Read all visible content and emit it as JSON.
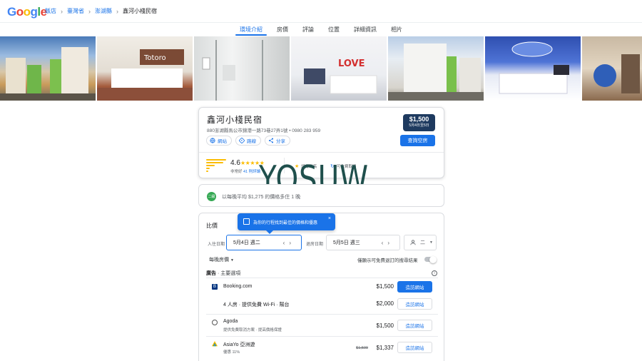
{
  "header": {
    "logo": "Google",
    "breadcrumbs": [
      "飯店",
      "臺灣省",
      "澎湖縣",
      "鑫河小棧民宿"
    ]
  },
  "tabs": [
    {
      "label": "環境介紹",
      "active": true
    },
    {
      "label": "房價",
      "active": false
    },
    {
      "label": "評論",
      "active": false
    },
    {
      "label": "位置",
      "active": false
    },
    {
      "label": "詳細資訊",
      "active": false
    },
    {
      "label": "相片",
      "active": false
    }
  ],
  "hotel": {
    "name": "鑫河小棧民宿",
    "address": "880澎湖縣馬公市錦港一路73巷27弄1號 • 0980 283 959",
    "actions": {
      "website": "網站",
      "directions": "路線",
      "share": "分享"
    },
    "price_badge": "$1,500",
    "price_badge_dates": "5月4日至5日",
    "check_button": "查詢空房",
    "rating": "4.6",
    "rating_text": "非常好",
    "review_count": "41 則評論",
    "feature_1": "評分最高",
    "feature_2": "可免費取消"
  },
  "watermark": "YOSUW",
  "promo": {
    "icon": "二級",
    "text": "以每晚平均 $1,275 的價格多住 1 晚"
  },
  "compare": {
    "title": "比價",
    "tooltip": "為你的行程找到最佳的價格和優惠",
    "checkin_label": "入住日期",
    "checkin_value": "5月4日 週二",
    "checkout_label": "退房日期",
    "checkout_value": "5月5日 週三",
    "guests": "二",
    "per_night": "每晚房價",
    "toggle_label": "僅顯示可免費退訂的搜尋結果",
    "ad_prefix": "廣告",
    "ad_title": "主要選項",
    "offers": [
      {
        "provider": "Booking.com",
        "sub": "",
        "price": "$1,500",
        "old_price": "",
        "button": "造訪網站",
        "primary": true
      },
      {
        "provider": "4 人房 · 提供免費 Wi-Fi · 陽台",
        "sub": "",
        "price": "$2,000",
        "old_price": "",
        "button": "造訪網站",
        "primary": false
      },
      {
        "provider": "Agoda",
        "sub": "提供免費取消方案 · 提高價格保證",
        "price": "$1,500",
        "old_price": "",
        "button": "造訪網站",
        "primary": false
      },
      {
        "provider": "AsiaYo 亞洲遊",
        "sub": "優惠 11%",
        "price": "$1,337",
        "old_price": "$1,500",
        "button": "造訪網站",
        "primary": false
      }
    ]
  },
  "colors": {
    "accent": "#1a73e8",
    "badge": "#1e3a5f",
    "star": "#fbbc04",
    "watermark": "#1f4f4c"
  }
}
